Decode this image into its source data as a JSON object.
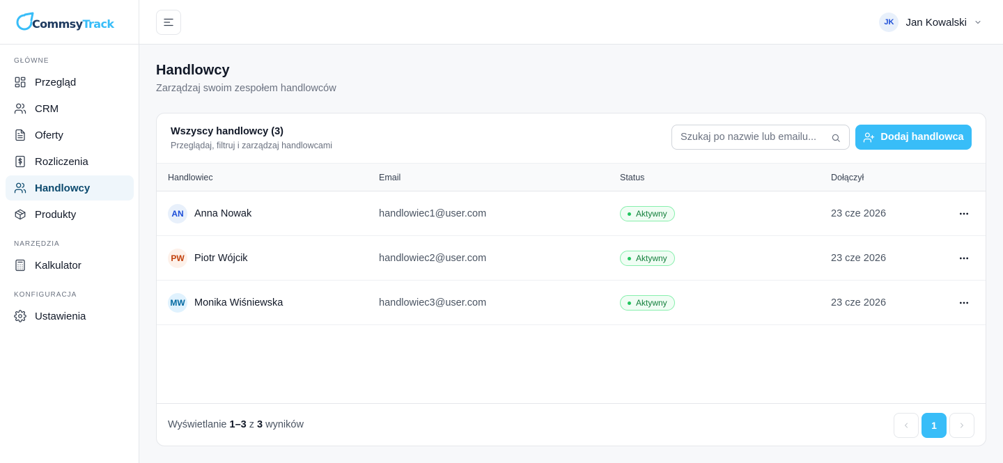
{
  "brand": {
    "name_part1": "Commsy",
    "name_part2": "Track",
    "color_dark": "#1e3a5f",
    "color_accent": "#38bdf8"
  },
  "sidebar": {
    "sections": [
      {
        "label": "GŁÓWNE",
        "items": [
          {
            "label": "Przegląd",
            "icon": "grid-icon"
          },
          {
            "label": "CRM",
            "icon": "users-icon"
          },
          {
            "label": "Oferty",
            "icon": "document-icon"
          },
          {
            "label": "Rozliczenia",
            "icon": "dollar-file-icon"
          },
          {
            "label": "Handlowcy",
            "icon": "team-icon",
            "active": true
          },
          {
            "label": "Produkty",
            "icon": "box-icon"
          }
        ]
      },
      {
        "label": "NARZĘDZIA",
        "items": [
          {
            "label": "Kalkulator",
            "icon": "calculator-icon"
          }
        ]
      },
      {
        "label": "KONFIGURACJA",
        "items": [
          {
            "label": "Ustawienia",
            "icon": "gear-icon"
          }
        ]
      }
    ]
  },
  "topbar": {
    "user_initials": "JK",
    "user_name": "Jan Kowalski"
  },
  "page": {
    "title": "Handlowcy",
    "subtitle": "Zarządzaj swoim zespołem handlowców"
  },
  "card": {
    "title": "Wszyscy handlowcy (3)",
    "subtitle": "Przeglądaj, filtruj i zarządzaj handlowcami",
    "search_placeholder": "Szukaj po nazwie lub emailu...",
    "add_button": "Dodaj handlowca"
  },
  "table": {
    "columns": [
      "Handlowiec",
      "Email",
      "Status",
      "Dołączył"
    ],
    "rows": [
      {
        "initials": "AN",
        "name": "Anna Nowak",
        "email": "handlowiec1@user.com",
        "status": "Aktywny",
        "joined": "23 cze 2026",
        "avatar_bg": "#e8f0fb",
        "avatar_fg": "#1d4ed8"
      },
      {
        "initials": "PW",
        "name": "Piotr Wójcik",
        "email": "handlowiec2@user.com",
        "status": "Aktywny",
        "joined": "23 cze 2026",
        "avatar_bg": "#fdf1ea",
        "avatar_fg": "#c2410c"
      },
      {
        "initials": "MW",
        "name": "Monika Wiśniewska",
        "email": "handlowiec3@user.com",
        "status": "Aktywny",
        "joined": "23 cze 2026",
        "avatar_bg": "#e0f2fe",
        "avatar_fg": "#0369a1"
      }
    ]
  },
  "footer": {
    "prefix": "Wyświetlanie ",
    "range": "1–3",
    "mid": " z ",
    "total": "3",
    "suffix": " wyników",
    "current_page": "1"
  }
}
